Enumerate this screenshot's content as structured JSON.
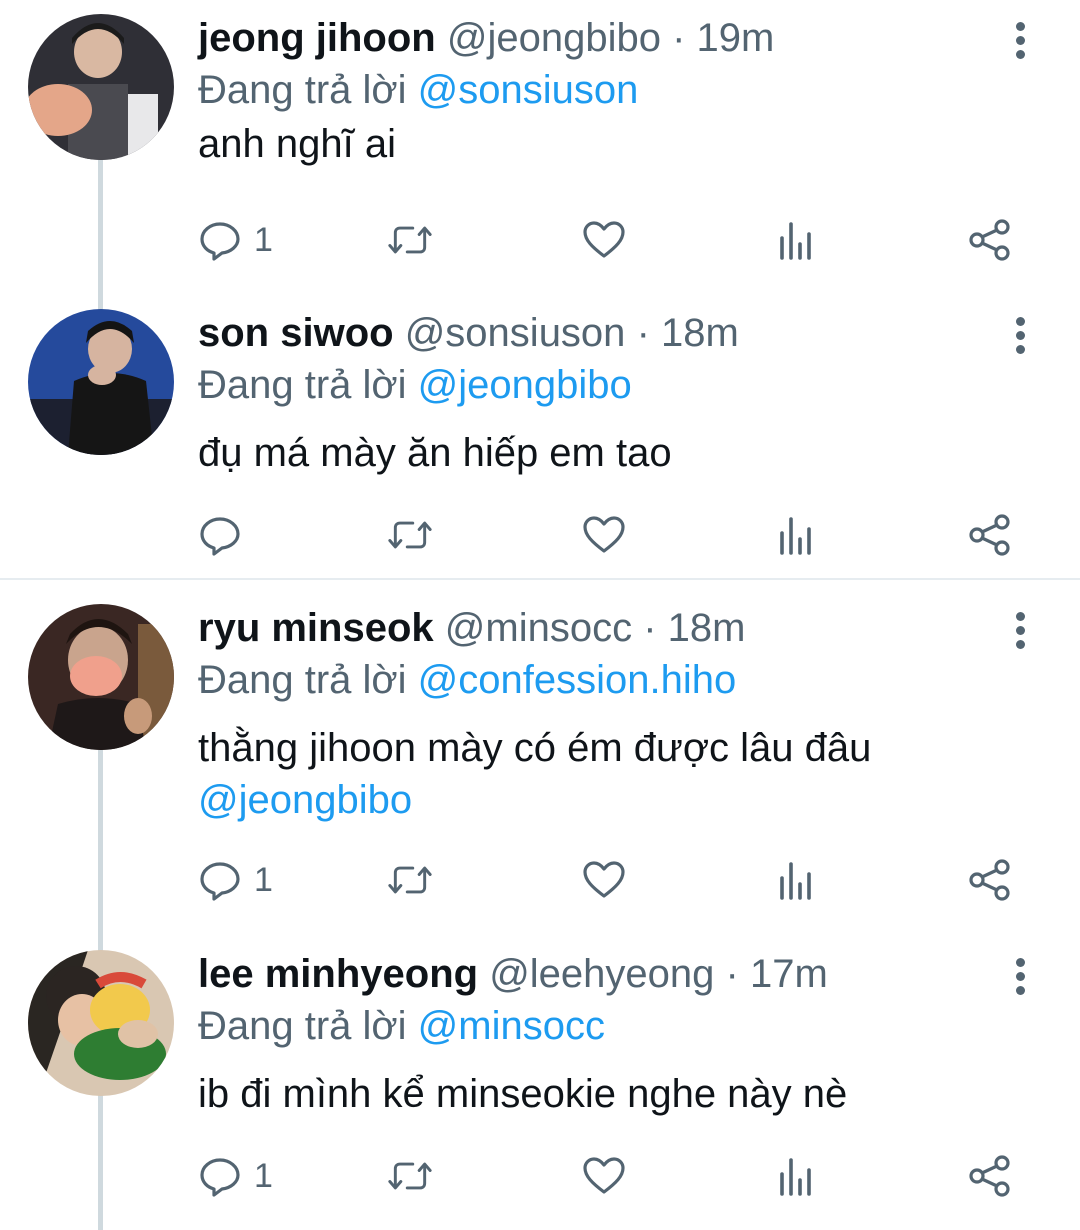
{
  "reply_prefix": "Đang trả lời",
  "tweets": [
    {
      "name": "jeong jihoon",
      "handle": "@jeongbibo",
      "time": "· 19m",
      "reply_to": "@sonsiuson",
      "text_plain": "anh nghĩ ai",
      "text_mention": "",
      "reply_count": "1",
      "avatar_colors": [
        "#3a3a40",
        "#e2b59a"
      ]
    },
    {
      "name": "son siwoo",
      "handle": "@sonsiuson",
      "time": "· 18m",
      "reply_to": "@jeongbibo",
      "text_plain": "đụ má mày ăn hiếp em tao",
      "text_mention": "",
      "reply_count": "",
      "avatar_colors": [
        "#2b4f9e",
        "#1a1a1a"
      ]
    },
    {
      "name": "ryu minseok",
      "handle": "@minsocc",
      "time": "· 18m",
      "reply_to": "@confession.hiho",
      "text_plain": "thằng jihoon mày có ém được lâu đâu",
      "text_mention": "@jeongbibo",
      "reply_count": "1",
      "avatar_colors": [
        "#3b2a25",
        "#e9a893"
      ]
    },
    {
      "name": "lee minhyeong",
      "handle": "@leehyeong",
      "time": "· 17m",
      "reply_to": "@minsocc",
      "text_plain": "ib đi mình kể minseokie nghe này nè",
      "text_mention": "",
      "reply_count": "1",
      "avatar_colors": [
        "#d8c4ae",
        "#f2c94c"
      ]
    }
  ],
  "colors": {
    "mention": "#1d9bf0",
    "secondary": "#536471",
    "thread_line": "#cfd9de"
  }
}
